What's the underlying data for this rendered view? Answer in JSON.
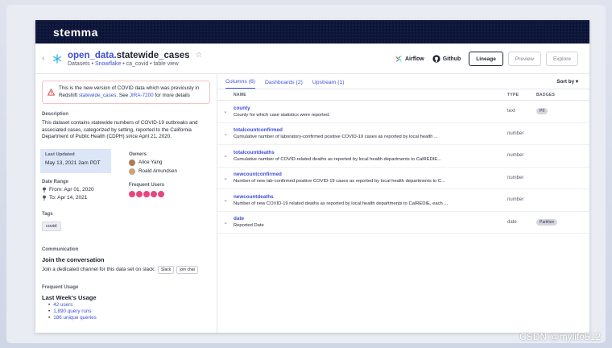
{
  "app": {
    "logo": "stemma"
  },
  "header": {
    "title_prefix": "open_data",
    "title_dot": ".",
    "title_main": "statewide_cases",
    "breadcrumb_a": "Datasets • ",
    "breadcrumb_link": "Snowflake",
    "breadcrumb_b": " • ca_covid • table view",
    "airflow_label": "Airflow",
    "github_label": "Github",
    "lineage_label": "Lineage",
    "preview_label": "Preview",
    "explore_label": "Explore"
  },
  "alert": {
    "text_a": "This is the new version of COVID data which was previously in Redshift ",
    "link_a": "statewide_cases",
    "text_b": ". See ",
    "link_b": "JIRA-7200",
    "text_c": " for more details"
  },
  "left": {
    "description_label": "Description",
    "description": "This dataset contains statewide numbers of COVID-19 outbreaks and associated cases, categorized by setting, reported to the California Department of Public Health (CDPH) since April 21, 2020.",
    "last_updated_label": "Last Updated",
    "last_updated": "May 13, 2021 2am PDT",
    "owners_label": "Owners",
    "owners": [
      "Alice Yang",
      "Roald Amundsen"
    ],
    "date_range_label": "Date Range",
    "from": "From: Apr 01, 2020",
    "to": "To:    Apr 14, 2021",
    "frequent_users_label": "Frequent Users",
    "tags_label": "Tags",
    "tag": "covid",
    "communication_label": "Communication",
    "join_title": "Join the conversation",
    "join_desc": "Join a dedicated channel for this data set on slack:",
    "slack_chip": "Slack",
    "join_chip": "join chat",
    "frequent_usage_label": "Frequent Usage",
    "usage_title": "Last Week's Usage",
    "usage": [
      "42 users",
      "1,890 query runs",
      "186 unique queries"
    ]
  },
  "right": {
    "tabs": [
      "Columns (6)",
      "Dashboards (2)",
      "Upstream (1)"
    ],
    "sort_by": "Sort by ▾",
    "col_headers": {
      "name": "NAME",
      "type": "TYPE",
      "badges": "BADGES"
    },
    "columns": [
      {
        "name": "county",
        "desc": "County for which case statistics were reported.",
        "type": "text",
        "badge": "PII"
      },
      {
        "name": "totalcountconfirmed",
        "desc": "Cumulative number of laboratory-confirmed positive COVID-19 cases as reported by local health ...",
        "type": "number",
        "badge": ""
      },
      {
        "name": "totalcountdeaths",
        "desc": "Cumulative number of COVID-related deaths as reported by local health departments to CalREDIE...",
        "type": "number",
        "badge": ""
      },
      {
        "name": "newcountconfirmed",
        "desc": "Number of new lab-confirmed positive COVID-19 cases as reported by local health departments to C...",
        "type": "number",
        "badge": ""
      },
      {
        "name": "newcountdeaths",
        "desc": "Number of new COVID-19 related deaths as reported by local health departments to CalREDIE, each ...",
        "type": "number",
        "badge": ""
      },
      {
        "name": "date",
        "desc": "Reported Date",
        "type": "date",
        "badge": "Partition"
      }
    ]
  },
  "watermark": "CSDN @mylife512",
  "colors": {
    "nav_bg": "#0c1438",
    "accent": "#3d4fd6",
    "alert_border": "#f0c4c4",
    "updated_bg": "#dde6f7",
    "avatar_pink": "#e8457f"
  }
}
